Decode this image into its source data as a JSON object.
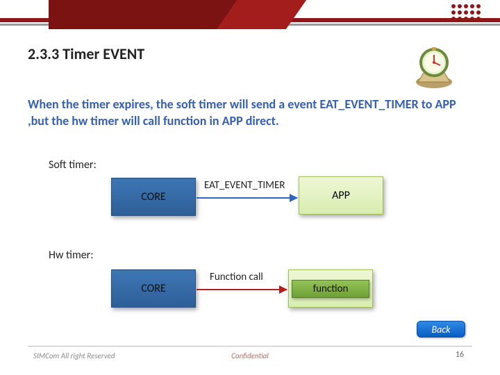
{
  "header": {
    "title": "2.3.3 Timer EVENT"
  },
  "description": "When the timer expires, the soft timer will send a event EAT_EVENT_TIMER to APP ,but the hw timer will call function in APP direct.",
  "soft_timer": {
    "label": "Soft timer:",
    "core": "CORE",
    "arrow_label": "EAT_EVENT_TIMER",
    "target": "APP"
  },
  "hw_timer": {
    "label": "Hw timer:",
    "core": "CORE",
    "arrow_label": "Function call",
    "target": "function"
  },
  "back_button": "Back",
  "footer": {
    "left": "SIMCom All right Reserved",
    "center": "Confidential",
    "page": "16"
  }
}
